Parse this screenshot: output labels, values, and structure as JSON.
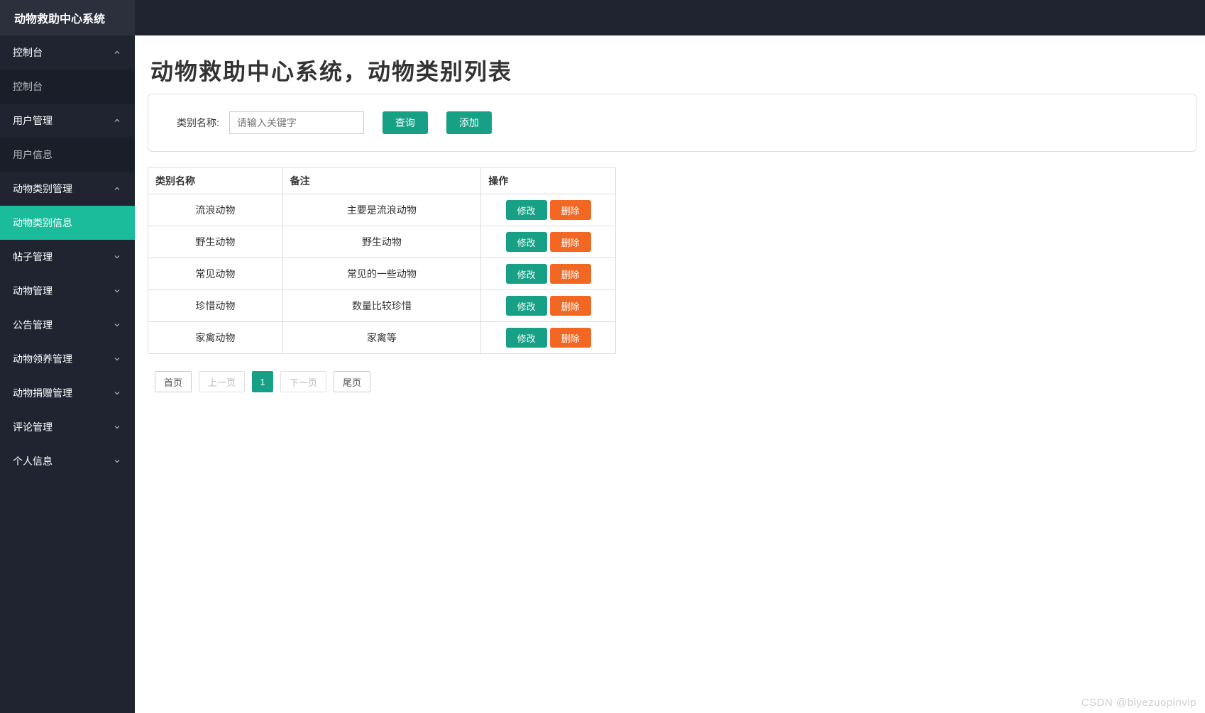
{
  "brand": "动物救助中心系统",
  "sidebar": {
    "groups": [
      {
        "label": "控制台",
        "expanded": true,
        "children": [
          {
            "label": "控制台",
            "active": false
          }
        ]
      },
      {
        "label": "用户管理",
        "expanded": true,
        "children": [
          {
            "label": "用户信息",
            "active": false
          }
        ]
      },
      {
        "label": "动物类别管理",
        "expanded": true,
        "children": [
          {
            "label": "动物类别信息",
            "active": true
          }
        ]
      },
      {
        "label": "帖子管理",
        "expanded": false
      },
      {
        "label": "动物管理",
        "expanded": false
      },
      {
        "label": "公告管理",
        "expanded": false
      },
      {
        "label": "动物领养管理",
        "expanded": false
      },
      {
        "label": "动物捐赠管理",
        "expanded": false
      },
      {
        "label": "评论管理",
        "expanded": false
      },
      {
        "label": "个人信息",
        "expanded": false
      }
    ]
  },
  "page": {
    "title": "动物救助中心系统，动物类别列表"
  },
  "search": {
    "label": "类别名称:",
    "placeholder": "请输入关键字",
    "value": "",
    "query_btn": "查询",
    "add_btn": "添加"
  },
  "table": {
    "headers": {
      "name": "类别名称",
      "note": "备注",
      "op": "操作"
    },
    "rows": [
      {
        "name": "流浪动物",
        "note": "主要是流浪动物"
      },
      {
        "name": "野生动物",
        "note": "野生动物"
      },
      {
        "name": "常见动物",
        "note": "常见的一些动物"
      },
      {
        "name": "珍惜动物",
        "note": "数量比较珍惜"
      },
      {
        "name": "家禽动物",
        "note": "家禽等"
      }
    ],
    "op_edit": "修改",
    "op_delete": "删除"
  },
  "pagination": {
    "first": "首页",
    "prev": "上一页",
    "pages": [
      "1"
    ],
    "current": "1",
    "next": "下一页",
    "last": "尾页"
  },
  "watermark": "CSDN @biyezuopinvip"
}
